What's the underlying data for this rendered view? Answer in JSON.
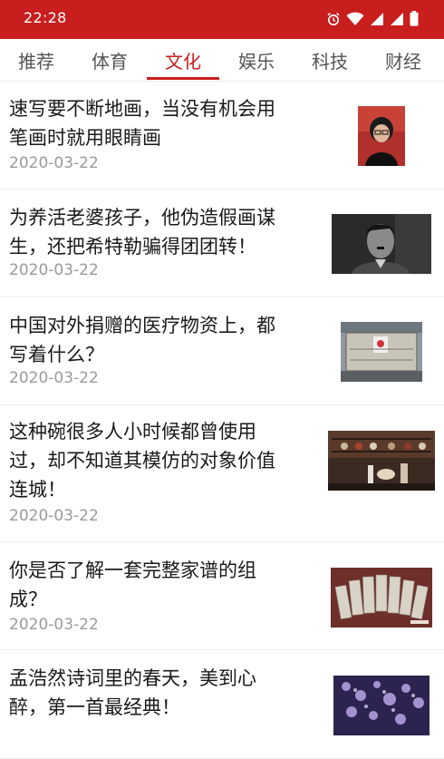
{
  "status_bar": {
    "time": "22:28",
    "icons": [
      "alarm-icon",
      "wifi-icon",
      "signal-icon",
      "signal-icon",
      "battery-icon"
    ],
    "background": "#c81e1e"
  },
  "tabs": [
    {
      "label": "推荐",
      "active": false
    },
    {
      "label": "体育",
      "active": false
    },
    {
      "label": "文化",
      "active": true
    },
    {
      "label": "娱乐",
      "active": false
    },
    {
      "label": "科技",
      "active": false
    },
    {
      "label": "财经",
      "active": false
    }
  ],
  "accent_color": "#c81e1e",
  "articles": [
    {
      "title_lines": [
        "速写要不断地画，当没有机会用",
        "笔画时就用眼睛画"
      ],
      "date": "2020-03-22",
      "thumbnail": "portrait-photo"
    },
    {
      "title_lines": [
        "为养活老婆孩子，他伪造假画谋",
        "生，还把希特勒骗得团团转！"
      ],
      "date": "2020-03-22",
      "thumbnail": "bw-portrait-photo"
    },
    {
      "title_lines": [
        "中国对外捐赠的医疗物资上，都",
        "写着什么？"
      ],
      "date": "2020-03-22",
      "thumbnail": "cargo-pallet-photo"
    },
    {
      "title_lines": [
        "这种碗很多人小时候都曾使用",
        "过，却不知道其模仿的对象价值",
        "连城！"
      ],
      "date": "2020-03-22",
      "thumbnail": "porcelain-shelf-photo"
    },
    {
      "title_lines": [
        "你是否了解一套完整家谱的组",
        "成？"
      ],
      "date": "2020-03-22",
      "thumbnail": "genealogy-books-photo"
    },
    {
      "title_lines": [
        "孟浩然诗词里的春天，美到心",
        "醉，第一首最经典！"
      ],
      "date": "",
      "thumbnail": "spring-blossom-photo"
    }
  ]
}
